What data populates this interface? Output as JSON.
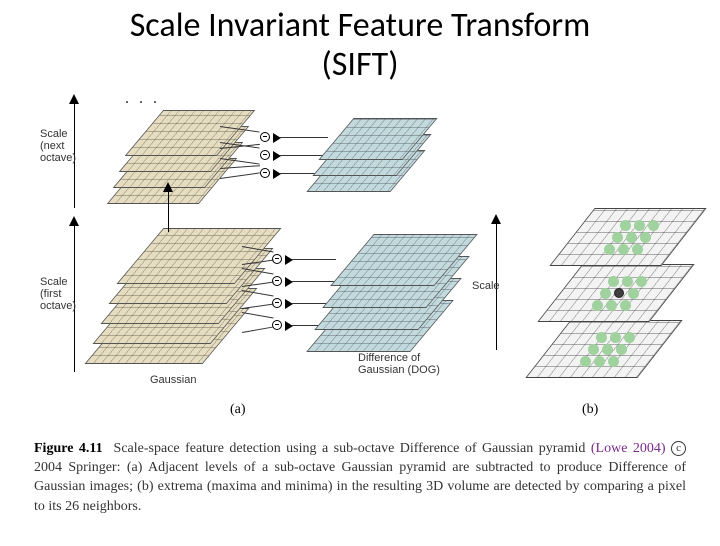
{
  "title_line1": "Scale Invariant Feature Transform",
  "title_line2": "(SIFT)",
  "labels": {
    "ellipsis": ". . .",
    "scale_next": "Scale\n(next\noctave)",
    "scale_first": "Scale\n(first\noctave)",
    "gaussian": "Gaussian",
    "dog": "Difference of\nGaussian (DOG)",
    "scale_b": "Scale",
    "a": "(a)",
    "b": "(b)"
  },
  "caption": {
    "fig": "Figure 4.11",
    "lead": " Scale-space feature detection using a sub-octave Difference of Gaussian pyramid ",
    "ref": "(Lowe 2004)",
    "copyright_c": "c",
    "copyright_rest": " 2004 Springer: (a) Adjacent levels of a sub-octave Gaussian pyramid are subtracted to produce Difference of Gaussian images; (b) extrema (maxima and minima) in the resulting 3D volume are detected by comparing a pixel to its 26 neighbors."
  }
}
